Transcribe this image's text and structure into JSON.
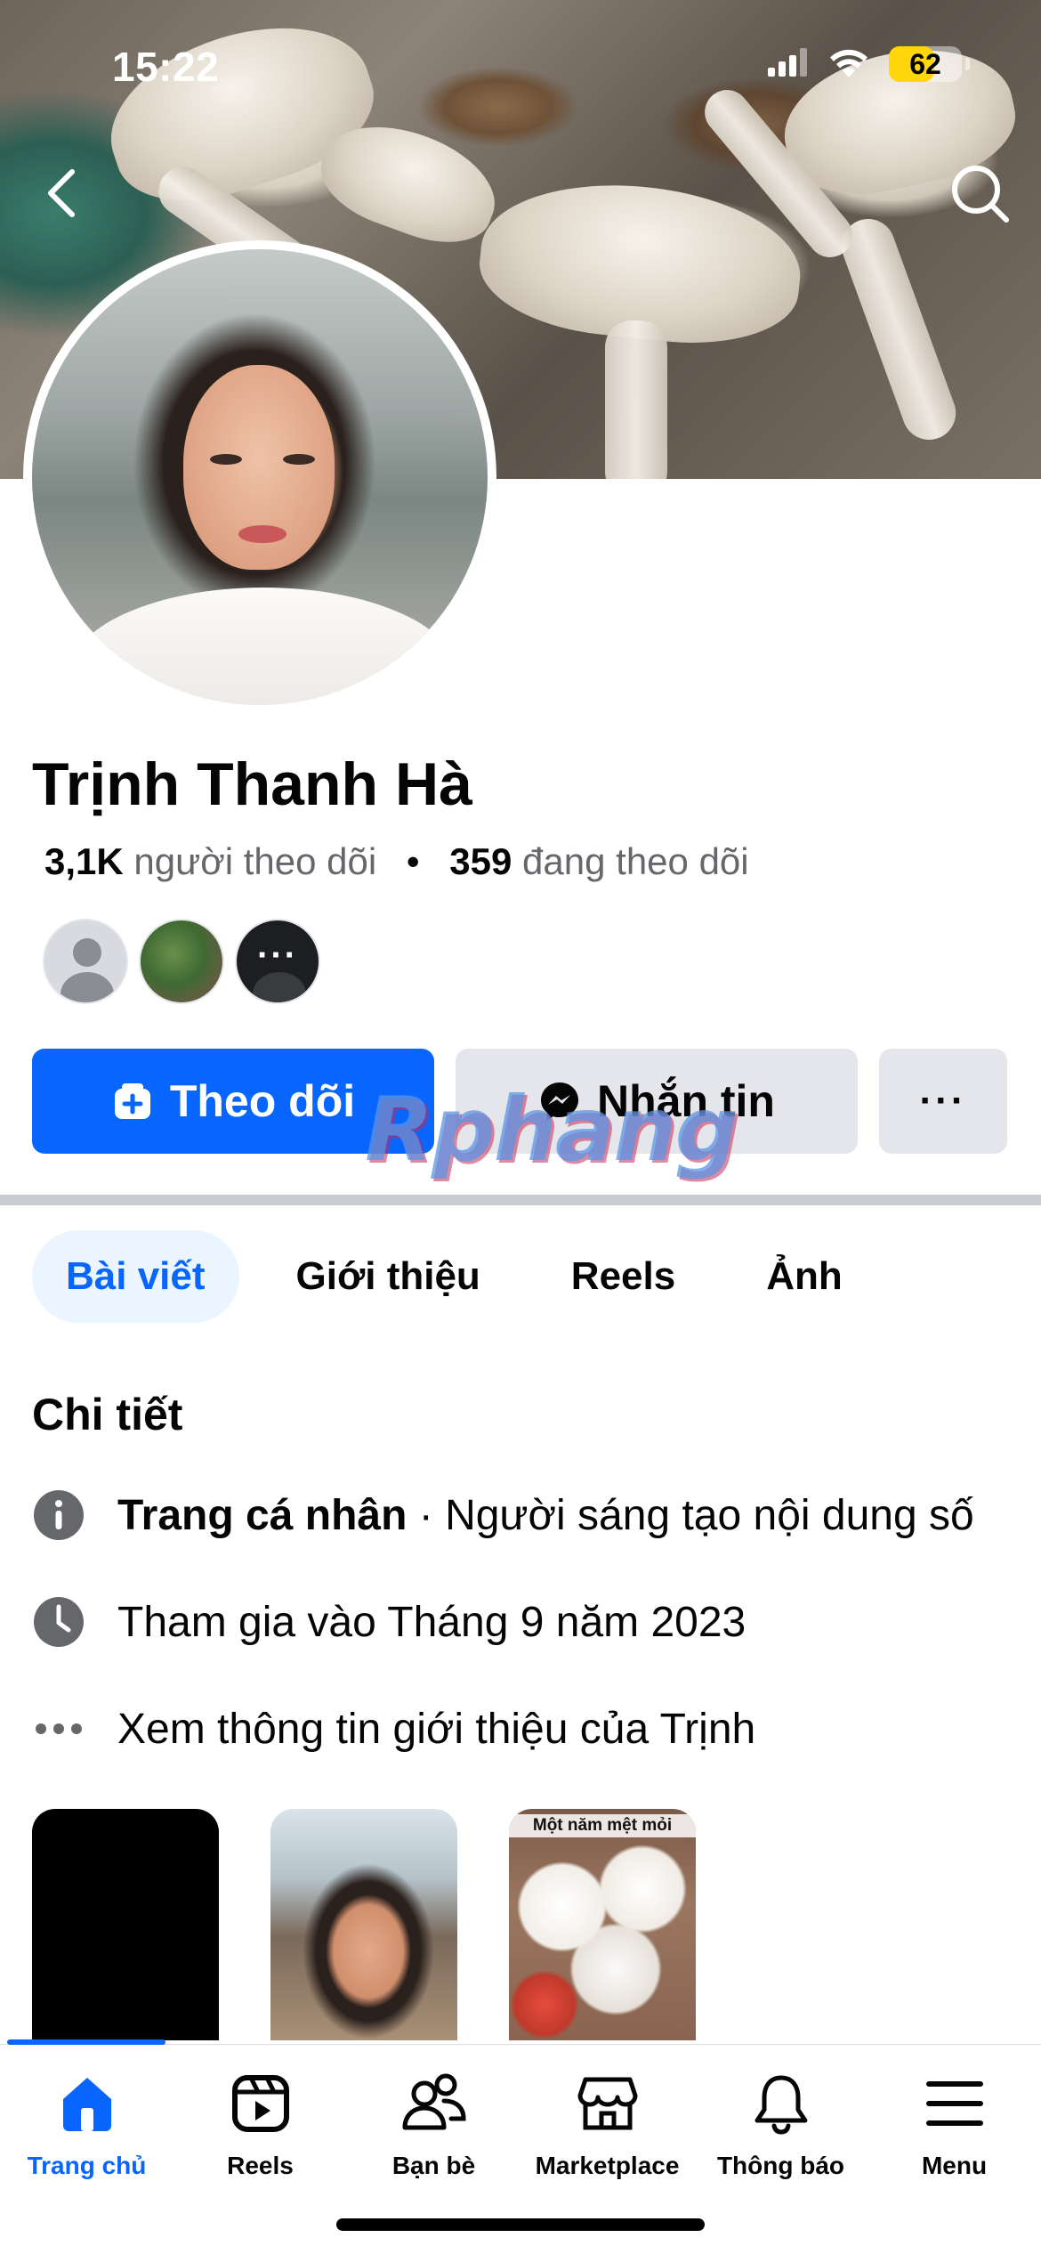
{
  "status_bar": {
    "time": "15:22",
    "battery": "62",
    "icons": [
      "signal-icon",
      "wifi-icon",
      "battery-icon"
    ]
  },
  "header": {
    "back_icon": "chevron-left-icon",
    "search_icon": "search-icon"
  },
  "profile": {
    "name": "Trịnh Thanh Hà",
    "followers_count": "3,1K",
    "followers_label": "người theo dõi",
    "separator": "•",
    "following_count": "359",
    "following_label": "đang theo dõi",
    "friend_more": "···"
  },
  "actions": {
    "follow_label": "Theo dõi",
    "message_label": "Nhắn tin",
    "more_label": "···"
  },
  "watermark": "Rphang",
  "tabs": [
    {
      "label": "Bài viết",
      "active": true
    },
    {
      "label": "Giới thiệu",
      "active": false
    },
    {
      "label": "Reels",
      "active": false
    },
    {
      "label": "Ảnh",
      "active": false
    }
  ],
  "details": {
    "title": "Chi tiết",
    "rows": [
      {
        "icon": "info-icon",
        "bold": "Trang cá nhân",
        "text": " · Người sáng tạo nội dung số"
      },
      {
        "icon": "clock-icon",
        "bold": "",
        "text": "Tham gia vào Tháng 9 năm 2023"
      },
      {
        "icon": "ellipsis-icon",
        "bold": "",
        "text": "Xem thông tin giới thiệu của Trịnh"
      }
    ]
  },
  "thumbnails": {
    "food_caption": "Một  năm mệt mỏi"
  },
  "bottom_nav": [
    {
      "label": "Trang chủ",
      "icon": "home-icon",
      "active": true
    },
    {
      "label": "Reels",
      "icon": "reels-icon",
      "active": false
    },
    {
      "label": "Bạn bè",
      "icon": "friends-icon",
      "active": false
    },
    {
      "label": "Marketplace",
      "icon": "marketplace-icon",
      "active": false
    },
    {
      "label": "Thông báo",
      "icon": "bell-icon",
      "active": false
    },
    {
      "label": "Menu",
      "icon": "menu-icon",
      "active": false
    }
  ],
  "colors": {
    "accent": "#0866ff",
    "tab_active_bg": "#ebf5ff",
    "button_gray": "#e4e6eb",
    "battery": "#ffd60a"
  }
}
